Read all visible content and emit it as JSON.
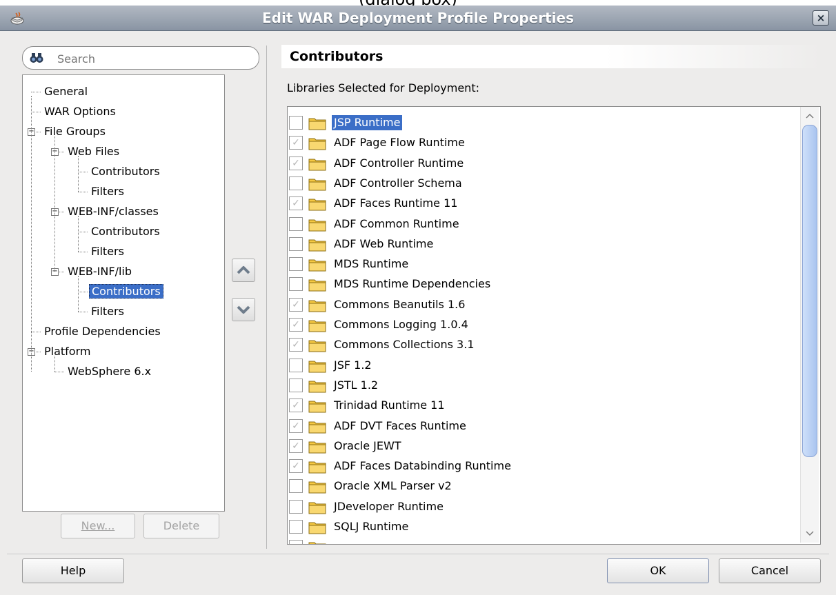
{
  "caption_fragment": "(dialog box)",
  "window": {
    "title": "Edit WAR Deployment Profile Properties",
    "close_label": "×"
  },
  "search": {
    "placeholder": "Search",
    "value": ""
  },
  "tree": [
    {
      "label": "General",
      "depth": 0,
      "expander": "",
      "selected": false
    },
    {
      "label": "WAR Options",
      "depth": 0,
      "expander": "",
      "selected": false
    },
    {
      "label": "File Groups",
      "depth": 0,
      "expander": "-",
      "selected": false
    },
    {
      "label": "Web Files",
      "depth": 1,
      "expander": "-",
      "selected": false
    },
    {
      "label": "Contributors",
      "depth": 2,
      "expander": "",
      "selected": false
    },
    {
      "label": "Filters",
      "depth": 2,
      "expander": "",
      "selected": false
    },
    {
      "label": "WEB-INF/classes",
      "depth": 1,
      "expander": "-",
      "selected": false
    },
    {
      "label": "Contributors",
      "depth": 2,
      "expander": "",
      "selected": false
    },
    {
      "label": "Filters",
      "depth": 2,
      "expander": "",
      "selected": false
    },
    {
      "label": "WEB-INF/lib",
      "depth": 1,
      "expander": "-",
      "selected": false
    },
    {
      "label": "Contributors",
      "depth": 2,
      "expander": "",
      "selected": true
    },
    {
      "label": "Filters",
      "depth": 2,
      "expander": "",
      "selected": false
    },
    {
      "label": "Profile Dependencies",
      "depth": 0,
      "expander": "",
      "selected": false
    },
    {
      "label": "Platform",
      "depth": 0,
      "expander": "-",
      "selected": false
    },
    {
      "label": "WebSphere 6.x",
      "depth": 1,
      "expander": "",
      "selected": false
    }
  ],
  "left_buttons": {
    "new_label": "New...",
    "delete_label": "Delete"
  },
  "section": {
    "title": "Contributors",
    "libraries_caption": "Libraries Selected for Deployment:"
  },
  "libraries": [
    {
      "name": "JSP Runtime",
      "checked": false,
      "selected": true
    },
    {
      "name": "ADF Page Flow Runtime",
      "checked": true,
      "selected": false
    },
    {
      "name": "ADF Controller Runtime",
      "checked": true,
      "selected": false
    },
    {
      "name": "ADF Controller Schema",
      "checked": false,
      "selected": false
    },
    {
      "name": "ADF Faces Runtime 11",
      "checked": true,
      "selected": false
    },
    {
      "name": "ADF Common Runtime",
      "checked": false,
      "selected": false
    },
    {
      "name": "ADF Web Runtime",
      "checked": false,
      "selected": false
    },
    {
      "name": "MDS Runtime",
      "checked": false,
      "selected": false
    },
    {
      "name": "MDS Runtime Dependencies",
      "checked": false,
      "selected": false
    },
    {
      "name": "Commons Beanutils 1.6",
      "checked": true,
      "selected": false
    },
    {
      "name": "Commons Logging 1.0.4",
      "checked": true,
      "selected": false
    },
    {
      "name": "Commons Collections 3.1",
      "checked": true,
      "selected": false
    },
    {
      "name": "JSF 1.2",
      "checked": false,
      "selected": false
    },
    {
      "name": "JSTL 1.2",
      "checked": false,
      "selected": false
    },
    {
      "name": "Trinidad Runtime 11",
      "checked": true,
      "selected": false
    },
    {
      "name": "ADF DVT Faces Runtime",
      "checked": true,
      "selected": false
    },
    {
      "name": "Oracle JEWT",
      "checked": true,
      "selected": false
    },
    {
      "name": "ADF Faces Databinding Runtime",
      "checked": true,
      "selected": false
    },
    {
      "name": "Oracle XML Parser v2",
      "checked": false,
      "selected": false
    },
    {
      "name": "JDeveloper Runtime",
      "checked": false,
      "selected": false
    },
    {
      "name": "SQLJ Runtime",
      "checked": false,
      "selected": false
    },
    {
      "name": "",
      "checked": false,
      "selected": false
    }
  ],
  "footer": {
    "help_label": "Help",
    "ok_label": "OK",
    "cancel_label": "Cancel"
  },
  "colors": {
    "selection": "#3b6ec7",
    "titlebar": "#8994a3",
    "folder": "#f5c842",
    "dialog_bg": "#edeceb"
  }
}
